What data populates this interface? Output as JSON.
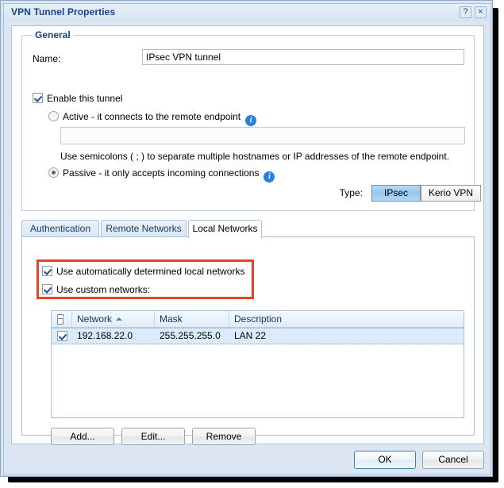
{
  "window": {
    "title": "VPN Tunnel Properties",
    "help_label": "?",
    "close_label": "×"
  },
  "general": {
    "legend": "General",
    "name_label": "Name:",
    "name_value": "IPsec VPN tunnel",
    "name_placeholder": "",
    "enable_checkbox": {
      "label": "Enable this tunnel",
      "checked": true
    },
    "mode": {
      "active": {
        "label": "Active - it connects to the remote endpoint",
        "selected": false,
        "info_icon": "info-icon",
        "info_glyph": "i"
      },
      "endpoint_value": "",
      "endpoint_placeholder": "",
      "endpoint_hint": "Use semicolons ( ; ) to separate multiple hostnames or IP addresses of the remote endpoint.",
      "passive": {
        "label": "Passive - it only accepts incoming connections",
        "selected": true,
        "info_icon": "info-icon",
        "info_glyph": "i"
      }
    },
    "type": {
      "label": "Type:",
      "options": [
        "IPsec",
        "Kerio VPN"
      ],
      "selected": "IPsec",
      "selected_color": "#96c6ee"
    }
  },
  "tabs": {
    "items": [
      {
        "label": "Authentication",
        "active": false
      },
      {
        "label": "Remote Networks",
        "active": false
      },
      {
        "label": "Local Networks",
        "active": true
      }
    ],
    "active_index": 2
  },
  "local_networks": {
    "auto_checkbox": {
      "label": "Use automatically determined local networks",
      "checked": true
    },
    "custom_checkbox": {
      "label": "Use custom networks:",
      "checked": true
    },
    "annotation": {
      "shape": "rectangle",
      "color": "#e8402a"
    },
    "table": {
      "columns": [
        "Network",
        "Mask",
        "Description"
      ],
      "sort_column": "Network",
      "sort_direction": "ascending",
      "select_all_icon": "header-select-checkbox-icon",
      "rows": [
        {
          "checked": true,
          "network": "192.168.22.0",
          "mask": "255.255.255.0",
          "description": "LAN 22",
          "selected": true
        }
      ]
    },
    "buttons": {
      "add": "Add...",
      "edit": "Edit...",
      "remove": "Remove"
    }
  },
  "footer": {
    "ok": "OK",
    "cancel": "Cancel"
  }
}
